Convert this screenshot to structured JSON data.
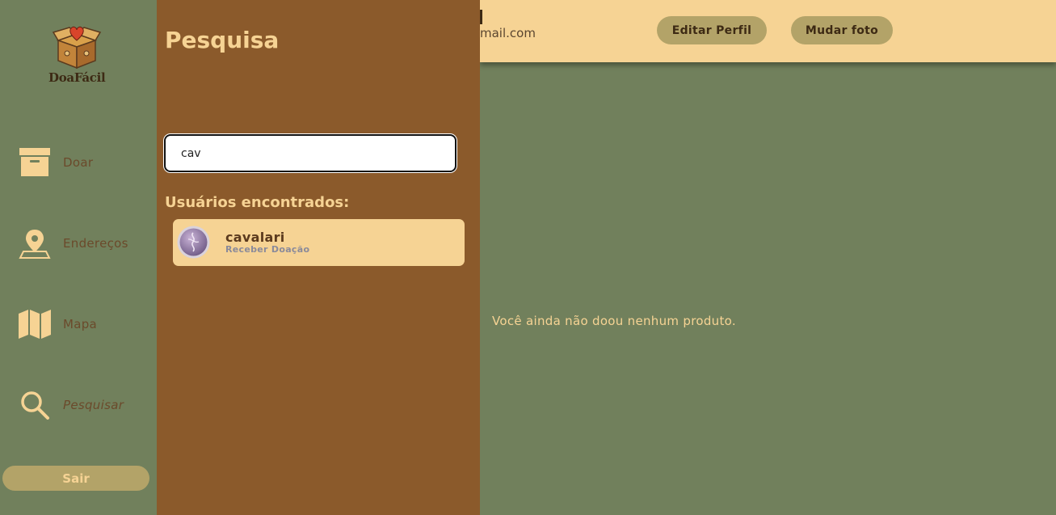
{
  "brand": {
    "name": "DoaFácil"
  },
  "sidebar": {
    "items": [
      {
        "label": "Doar",
        "icon": "box-icon"
      },
      {
        "label": "Endereços",
        "icon": "map-pin-icon"
      },
      {
        "label": "Mapa",
        "icon": "folded-map-icon"
      },
      {
        "label": "Pesquisar",
        "icon": "search-icon"
      }
    ],
    "logout_label": "Sair"
  },
  "header": {
    "email_partial": "mail.com",
    "edit_profile_label": "Editar Perfil",
    "change_photo_label": "Mudar foto"
  },
  "main": {
    "empty_message": "Você ainda não doou nenhum produto."
  },
  "search_panel": {
    "title": "Pesquisa",
    "query": "cav",
    "results_heading": "Usuários encontrados:",
    "results": [
      {
        "name": "cavalari",
        "role": "Receber Doação"
      }
    ]
  },
  "colors": {
    "background": "#71805c",
    "panel": "#8b5a2b",
    "accent": "#f6d394",
    "button": "#b3a368"
  }
}
